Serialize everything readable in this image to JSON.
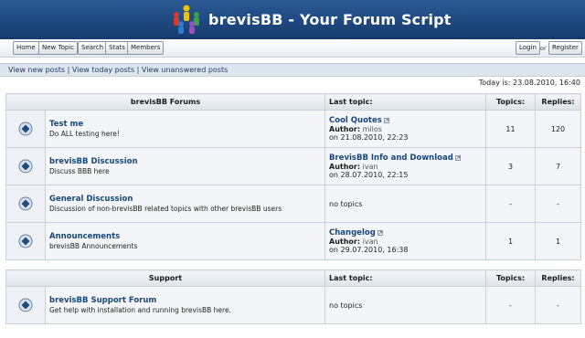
{
  "header": {
    "site_title": "brevisBB - Your Forum Script"
  },
  "nav": {
    "home": "Home",
    "new_topic": "New Topic",
    "search": "Search",
    "stats": "Stats",
    "members": "Members",
    "login": "Login",
    "or": "or",
    "register": "Register"
  },
  "viewbar": {
    "new_posts": "View new posts",
    "sep1": " | ",
    "today_posts": "View today posts",
    "sep2": " | ",
    "unanswered": "View unanswered posts"
  },
  "today": "Today is: 23.08.2010, 16:40",
  "sections": [
    {
      "title": "brevisBB Forums",
      "col_last": "Last topic:",
      "col_topics": "Topics:",
      "col_replies": "Replies:",
      "forums": [
        {
          "name": "Test me",
          "desc": "Do ALL testing here!",
          "last_topic": "Cool Quotes",
          "author_label": "Author:",
          "author": "milos",
          "date": "on 21.08.2010, 22:23",
          "topics": "11",
          "replies": "120"
        },
        {
          "name": "brevisBB Discussion",
          "desc": "Discuss BBB here",
          "last_topic": "BrevisBB Info and Download",
          "author_label": "Author:",
          "author": "ivan",
          "date": "on 28.07.2010, 22:15",
          "topics": "3",
          "replies": "7"
        },
        {
          "name": "General Discussion",
          "desc": "Discussion of non-brevisBB related topics with other brevisBB users",
          "no_topics": "no topics",
          "topics": "-",
          "replies": "-"
        },
        {
          "name": "Announcements",
          "desc": "brevisBB Announcements",
          "last_topic": "Changelog",
          "author_label": "Author:",
          "author": "ivan",
          "date": "on 29.07.2010, 16:38",
          "topics": "1",
          "replies": "1"
        }
      ]
    },
    {
      "title": "Support",
      "col_last": "Last topic:",
      "col_topics": "Topics:",
      "col_replies": "Replies:",
      "forums": [
        {
          "name": "brevisBB Support Forum",
          "desc": "Get help with installation and running brevisBB here.",
          "no_topics": "no topics",
          "topics": "-",
          "replies": "-"
        }
      ]
    }
  ],
  "icons": {
    "logo": "people-logo-icon",
    "forum": "forum-bullet-icon",
    "goto": "goto-last-post-icon"
  }
}
